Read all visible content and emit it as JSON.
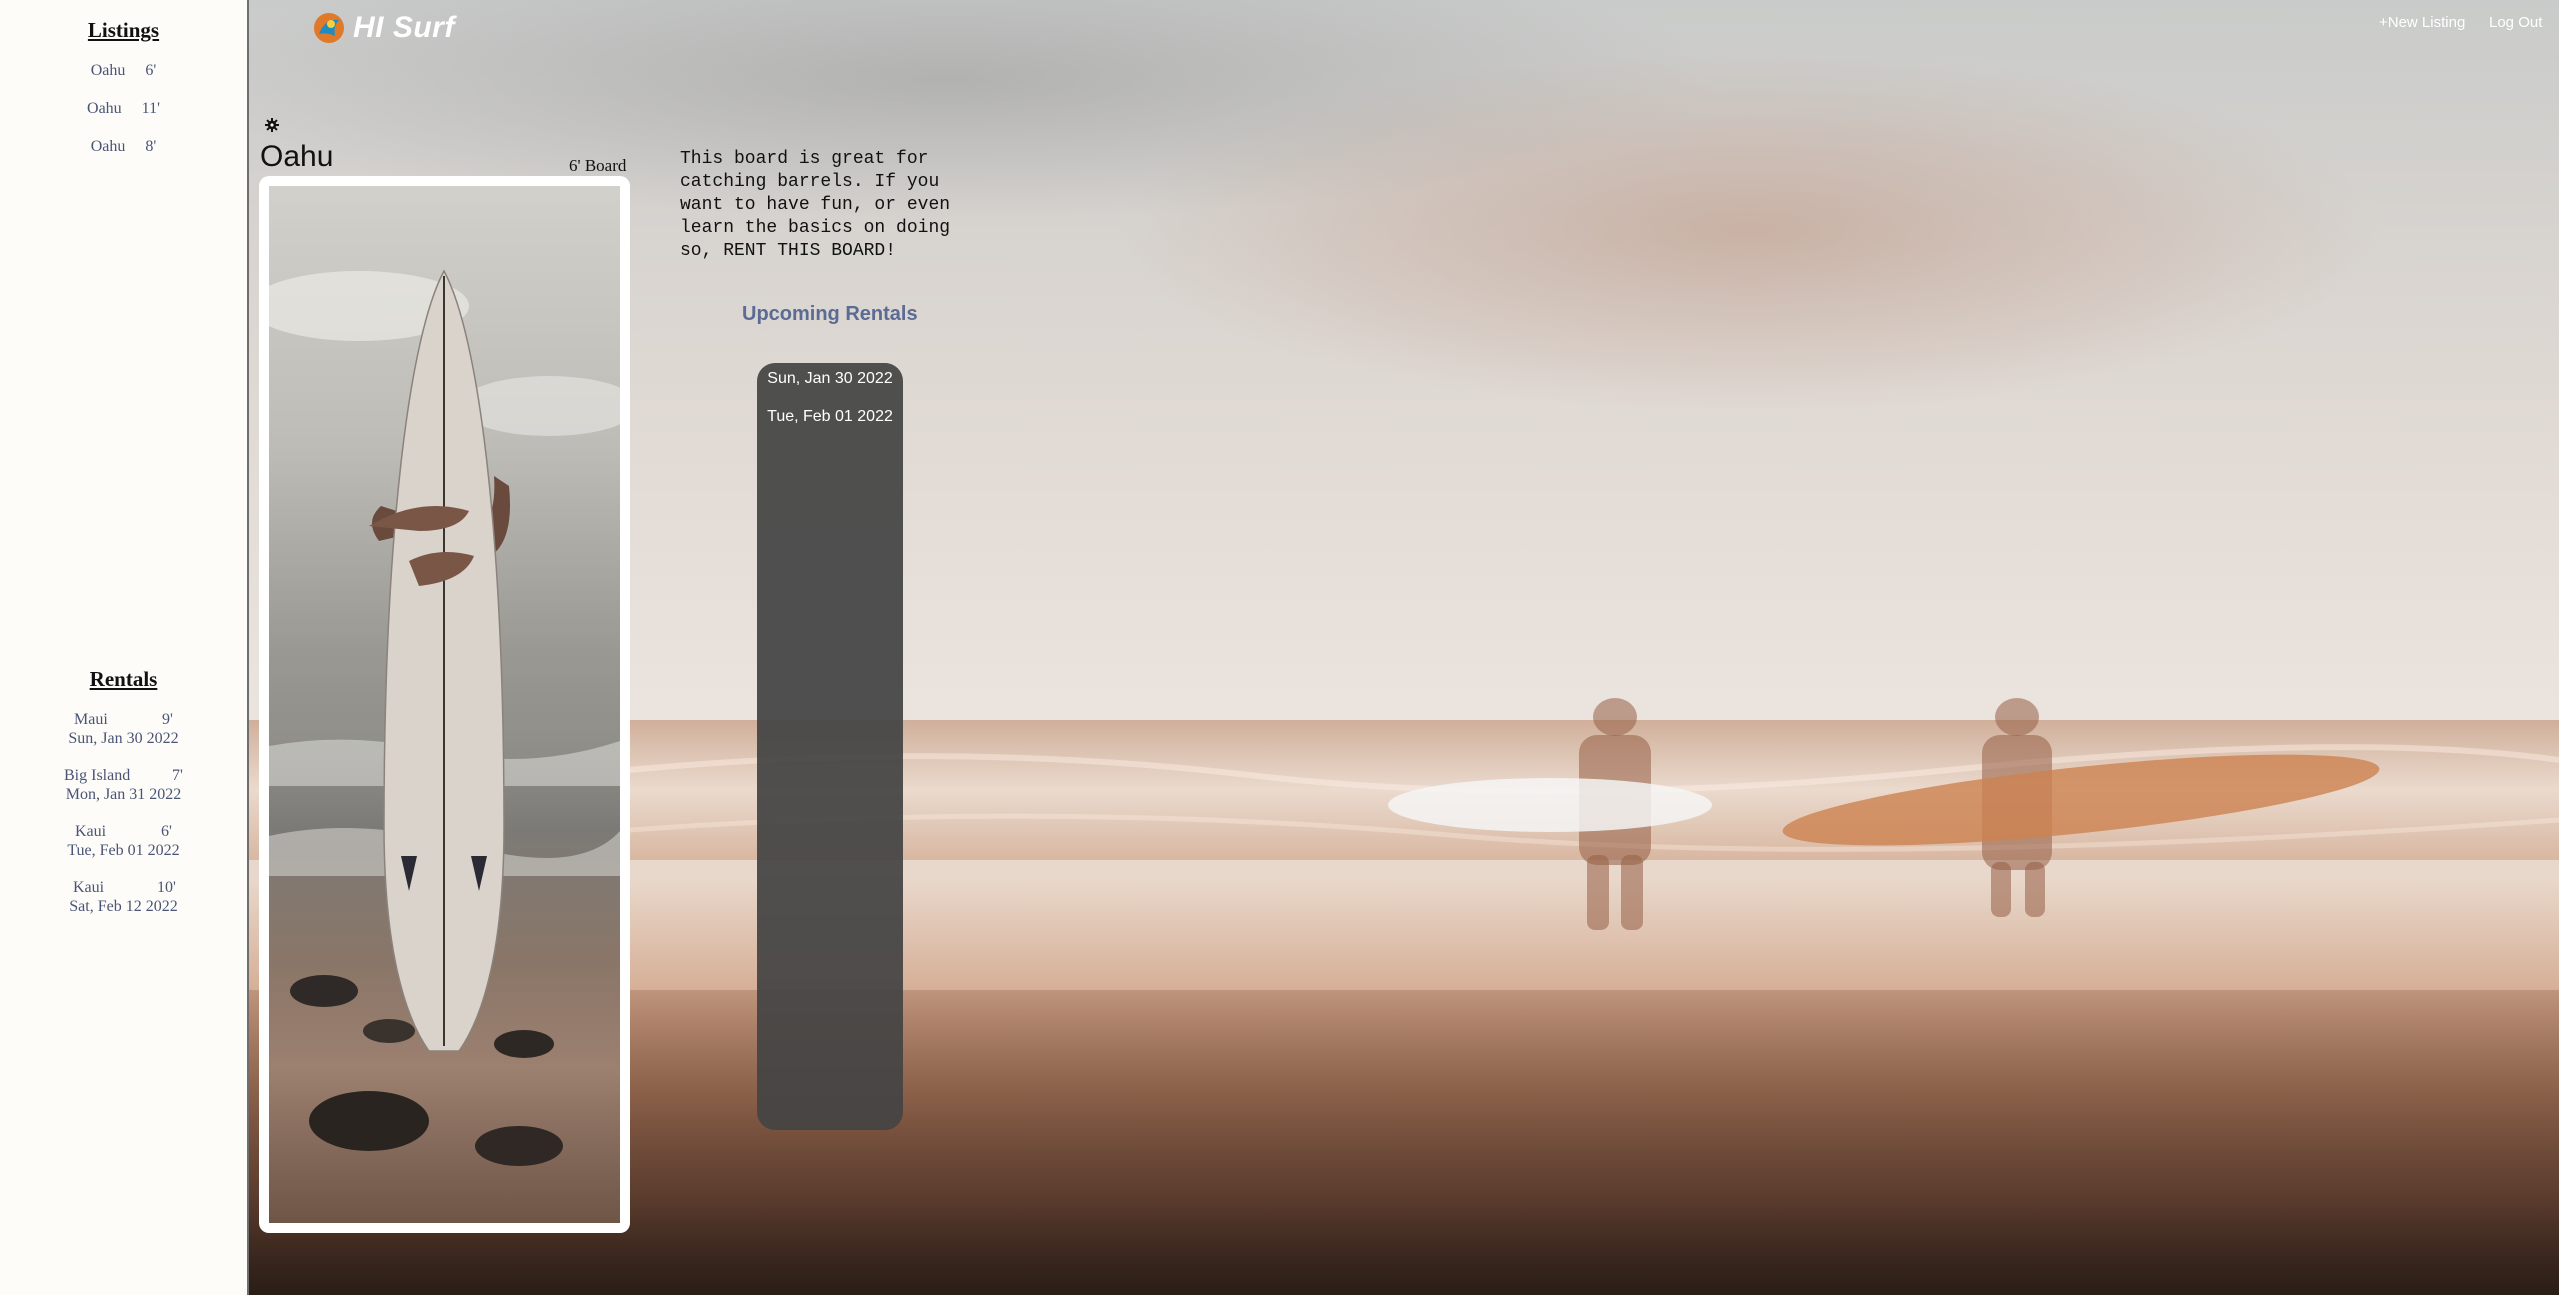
{
  "sidebar": {
    "listings_heading": "Listings",
    "listings": [
      {
        "location": "Oahu",
        "size": "6'"
      },
      {
        "location": "Oahu",
        "size": "11'"
      },
      {
        "location": "Oahu",
        "size": "8'"
      }
    ],
    "rentals_heading": "Rentals",
    "rentals": [
      {
        "location": "Maui",
        "size": "9'",
        "date": "Sun, Jan 30 2022"
      },
      {
        "location": "Big Island",
        "size": "7'",
        "date": "Mon, Jan 31 2022"
      },
      {
        "location": "Kaui",
        "size": "6'",
        "date": "Tue, Feb 01 2022"
      },
      {
        "location": "Kaui",
        "size": "10'",
        "date": "Sat, Feb 12 2022"
      }
    ]
  },
  "header": {
    "brand": "HI Surf",
    "new_listing": "+New Listing",
    "log_out": "Log Out"
  },
  "listing": {
    "title": "Oahu",
    "size_label": "6' Board",
    "description": "This board is great for catching barrels. If you want to have fun, or even learn the basics on doing so, RENT THIS BOARD!",
    "upcoming_heading": "Upcoming Rentals",
    "upcoming_dates": [
      "Sun, Jan 30 2022",
      "Tue, Feb 01 2022"
    ]
  },
  "icons": {
    "logo": "surf-logo-icon",
    "settings": "gear-icon"
  },
  "colors": {
    "sidebar_bg": "#fdfcf8",
    "link_text": "#4a5575",
    "upcoming_heading": "#5b6b93",
    "rentals_panel": "#444444"
  }
}
